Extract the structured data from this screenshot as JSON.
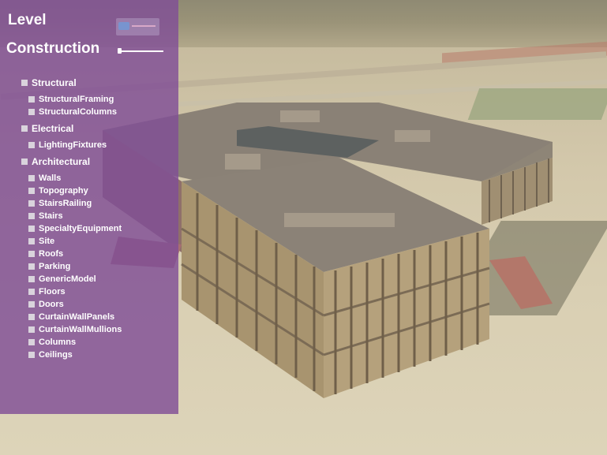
{
  "panel": {
    "title_level": "Level",
    "title_construction": "Construction",
    "groups": [
      {
        "label": "Structural",
        "items": [
          "StructuralFraming",
          "StructuralColumns"
        ]
      },
      {
        "label": "Electrical",
        "items": [
          "LightingFixtures"
        ]
      },
      {
        "label": "Architectural",
        "items": [
          "Walls",
          "Topography",
          "StairsRailing",
          "Stairs",
          "SpecialtyEquipment",
          "Site",
          "Roofs",
          "Parking",
          "GenericModel",
          "Floors",
          "Doors",
          "CurtainWallPanels",
          "CurtainWallMullions",
          "Columns",
          "Ceilings"
        ]
      }
    ]
  },
  "colors": {
    "panel": "#804e96",
    "checkbox": "#d9d3dc",
    "building": "#b9a889",
    "roof": "#8d8274"
  },
  "icons": {
    "logo": "logo-icon",
    "slider": "construction-slider"
  }
}
